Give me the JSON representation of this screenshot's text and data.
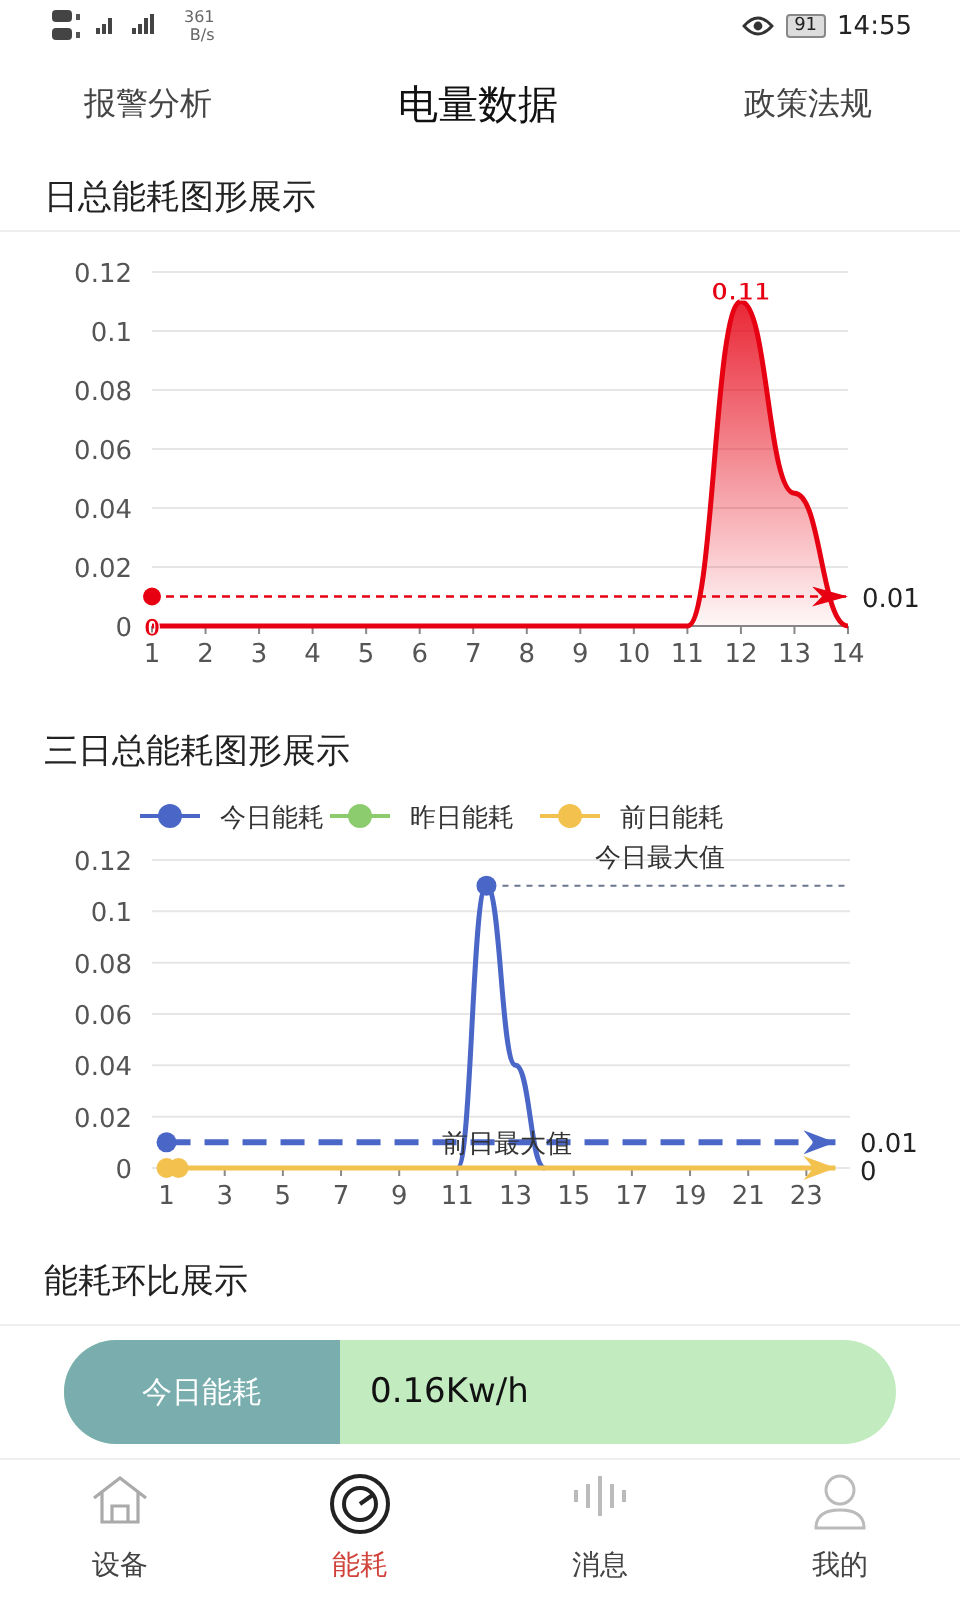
{
  "status_bar": {
    "speed": "361",
    "speed_unit": "B/s",
    "battery": "91",
    "time": "14:55"
  },
  "tabs": [
    {
      "label": "报警分析",
      "selected": false
    },
    {
      "label": "电量数据",
      "selected": true
    },
    {
      "label": "政策法规",
      "selected": false
    }
  ],
  "daily_chart": {
    "title": "日总能耗图形展示",
    "chart_data": {
      "type": "area",
      "x": [
        1,
        2,
        3,
        4,
        5,
        6,
        7,
        8,
        9,
        10,
        11,
        12,
        13,
        14
      ],
      "series": [
        {
          "color": "#e60012",
          "values": [
            0,
            0,
            0,
            0,
            0,
            0,
            0,
            0,
            0,
            0,
            0,
            0.11,
            0.045,
            0
          ]
        }
      ],
      "xlim": [
        1,
        14
      ],
      "ylim": [
        0,
        0.12
      ],
      "grid": true,
      "yticks": [
        0,
        0.02,
        0.04,
        0.06,
        0.08,
        0.1,
        0.12
      ],
      "xticks": [
        1,
        2,
        3,
        4,
        5,
        6,
        7,
        8,
        9,
        10,
        11,
        12,
        13,
        14
      ],
      "ref_lines": [
        {
          "axis": "y",
          "value": 0.01,
          "label": "0.01",
          "color": "#e60012"
        }
      ],
      "annotations": [
        {
          "text": "0.11",
          "x": 12,
          "y": 0.11
        },
        {
          "text": "0",
          "x": 1,
          "y": 0
        }
      ]
    }
  },
  "three_day_chart": {
    "title": "三日总能耗图形展示",
    "chart_data": {
      "type": "line",
      "x": [
        1,
        2,
        3,
        4,
        5,
        6,
        7,
        8,
        9,
        10,
        11,
        12,
        13,
        14,
        15,
        16,
        17,
        18,
        19,
        20,
        21,
        22,
        23,
        24
      ],
      "series": [
        {
          "name": "今日能耗",
          "color": "#4a67c8",
          "values": [
            null,
            null,
            null,
            null,
            null,
            null,
            null,
            null,
            null,
            null,
            0,
            0.11,
            0.04,
            0,
            null,
            null,
            null,
            null,
            null,
            null,
            null,
            null,
            null,
            null
          ]
        },
        {
          "name": "昨日能耗",
          "color": "#8ccb6e",
          "values": [
            null,
            null,
            null,
            null,
            null,
            null,
            null,
            null,
            null,
            null,
            null,
            null,
            null,
            null,
            null,
            null,
            null,
            null,
            null,
            null,
            null,
            null,
            null,
            null
          ]
        },
        {
          "name": "前日能耗",
          "color": "#f2c14e",
          "values": [
            0,
            0,
            0,
            0,
            0,
            0,
            0,
            0,
            0,
            0,
            0,
            0,
            0,
            0,
            0,
            0,
            0,
            0,
            0,
            0,
            0,
            0,
            0,
            0
          ]
        }
      ],
      "xlim": [
        0.5,
        24.5
      ],
      "ylim": [
        0,
        0.12
      ],
      "grid": true,
      "legend": "top",
      "yticks": [
        0,
        0.02,
        0.04,
        0.06,
        0.08,
        0.1,
        0.12
      ],
      "xticks": [
        1,
        3,
        5,
        7,
        9,
        11,
        13,
        15,
        17,
        19,
        21,
        23
      ],
      "ref_lines": [
        {
          "axis": "y",
          "value": 0.11,
          "label": "今日最大值",
          "color": "#6a7590"
        },
        {
          "axis": "y",
          "value": 0.01,
          "label": "0.01",
          "color": "#4a67c8"
        }
      ],
      "annotations": [
        {
          "text": "前日最大值"
        },
        {
          "text": "0"
        }
      ]
    }
  },
  "comparison": {
    "title": "能耗环比展示",
    "label": "今日能耗",
    "value": "0.16Kw/h"
  },
  "bottom_nav": [
    {
      "label": "设备",
      "selected": false
    },
    {
      "label": "能耗",
      "selected": true
    },
    {
      "label": "消息",
      "selected": false
    },
    {
      "label": "我的",
      "selected": false
    }
  ]
}
